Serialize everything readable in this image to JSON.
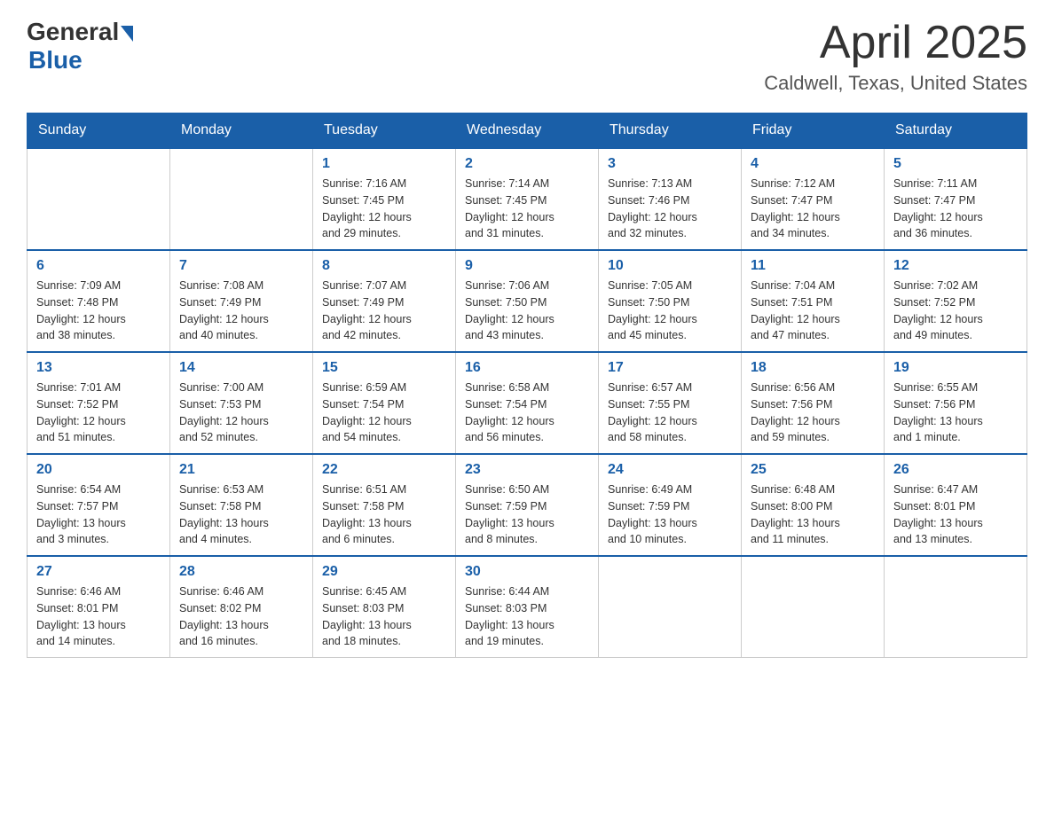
{
  "logo": {
    "general": "General",
    "blue": "Blue",
    "subtitle": "Blue"
  },
  "title": "April 2025",
  "subtitle": "Caldwell, Texas, United States",
  "days_of_week": [
    "Sunday",
    "Monday",
    "Tuesday",
    "Wednesday",
    "Thursday",
    "Friday",
    "Saturday"
  ],
  "weeks": [
    [
      {
        "day": "",
        "info": ""
      },
      {
        "day": "",
        "info": ""
      },
      {
        "day": "1",
        "info": "Sunrise: 7:16 AM\nSunset: 7:45 PM\nDaylight: 12 hours\nand 29 minutes."
      },
      {
        "day": "2",
        "info": "Sunrise: 7:14 AM\nSunset: 7:45 PM\nDaylight: 12 hours\nand 31 minutes."
      },
      {
        "day": "3",
        "info": "Sunrise: 7:13 AM\nSunset: 7:46 PM\nDaylight: 12 hours\nand 32 minutes."
      },
      {
        "day": "4",
        "info": "Sunrise: 7:12 AM\nSunset: 7:47 PM\nDaylight: 12 hours\nand 34 minutes."
      },
      {
        "day": "5",
        "info": "Sunrise: 7:11 AM\nSunset: 7:47 PM\nDaylight: 12 hours\nand 36 minutes."
      }
    ],
    [
      {
        "day": "6",
        "info": "Sunrise: 7:09 AM\nSunset: 7:48 PM\nDaylight: 12 hours\nand 38 minutes."
      },
      {
        "day": "7",
        "info": "Sunrise: 7:08 AM\nSunset: 7:49 PM\nDaylight: 12 hours\nand 40 minutes."
      },
      {
        "day": "8",
        "info": "Sunrise: 7:07 AM\nSunset: 7:49 PM\nDaylight: 12 hours\nand 42 minutes."
      },
      {
        "day": "9",
        "info": "Sunrise: 7:06 AM\nSunset: 7:50 PM\nDaylight: 12 hours\nand 43 minutes."
      },
      {
        "day": "10",
        "info": "Sunrise: 7:05 AM\nSunset: 7:50 PM\nDaylight: 12 hours\nand 45 minutes."
      },
      {
        "day": "11",
        "info": "Sunrise: 7:04 AM\nSunset: 7:51 PM\nDaylight: 12 hours\nand 47 minutes."
      },
      {
        "day": "12",
        "info": "Sunrise: 7:02 AM\nSunset: 7:52 PM\nDaylight: 12 hours\nand 49 minutes."
      }
    ],
    [
      {
        "day": "13",
        "info": "Sunrise: 7:01 AM\nSunset: 7:52 PM\nDaylight: 12 hours\nand 51 minutes."
      },
      {
        "day": "14",
        "info": "Sunrise: 7:00 AM\nSunset: 7:53 PM\nDaylight: 12 hours\nand 52 minutes."
      },
      {
        "day": "15",
        "info": "Sunrise: 6:59 AM\nSunset: 7:54 PM\nDaylight: 12 hours\nand 54 minutes."
      },
      {
        "day": "16",
        "info": "Sunrise: 6:58 AM\nSunset: 7:54 PM\nDaylight: 12 hours\nand 56 minutes."
      },
      {
        "day": "17",
        "info": "Sunrise: 6:57 AM\nSunset: 7:55 PM\nDaylight: 12 hours\nand 58 minutes."
      },
      {
        "day": "18",
        "info": "Sunrise: 6:56 AM\nSunset: 7:56 PM\nDaylight: 12 hours\nand 59 minutes."
      },
      {
        "day": "19",
        "info": "Sunrise: 6:55 AM\nSunset: 7:56 PM\nDaylight: 13 hours\nand 1 minute."
      }
    ],
    [
      {
        "day": "20",
        "info": "Sunrise: 6:54 AM\nSunset: 7:57 PM\nDaylight: 13 hours\nand 3 minutes."
      },
      {
        "day": "21",
        "info": "Sunrise: 6:53 AM\nSunset: 7:58 PM\nDaylight: 13 hours\nand 4 minutes."
      },
      {
        "day": "22",
        "info": "Sunrise: 6:51 AM\nSunset: 7:58 PM\nDaylight: 13 hours\nand 6 minutes."
      },
      {
        "day": "23",
        "info": "Sunrise: 6:50 AM\nSunset: 7:59 PM\nDaylight: 13 hours\nand 8 minutes."
      },
      {
        "day": "24",
        "info": "Sunrise: 6:49 AM\nSunset: 7:59 PM\nDaylight: 13 hours\nand 10 minutes."
      },
      {
        "day": "25",
        "info": "Sunrise: 6:48 AM\nSunset: 8:00 PM\nDaylight: 13 hours\nand 11 minutes."
      },
      {
        "day": "26",
        "info": "Sunrise: 6:47 AM\nSunset: 8:01 PM\nDaylight: 13 hours\nand 13 minutes."
      }
    ],
    [
      {
        "day": "27",
        "info": "Sunrise: 6:46 AM\nSunset: 8:01 PM\nDaylight: 13 hours\nand 14 minutes."
      },
      {
        "day": "28",
        "info": "Sunrise: 6:46 AM\nSunset: 8:02 PM\nDaylight: 13 hours\nand 16 minutes."
      },
      {
        "day": "29",
        "info": "Sunrise: 6:45 AM\nSunset: 8:03 PM\nDaylight: 13 hours\nand 18 minutes."
      },
      {
        "day": "30",
        "info": "Sunrise: 6:44 AM\nSunset: 8:03 PM\nDaylight: 13 hours\nand 19 minutes."
      },
      {
        "day": "",
        "info": ""
      },
      {
        "day": "",
        "info": ""
      },
      {
        "day": "",
        "info": ""
      }
    ]
  ]
}
